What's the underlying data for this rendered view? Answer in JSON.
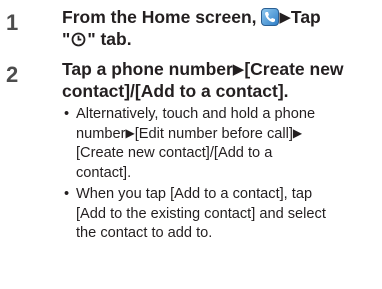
{
  "steps": [
    {
      "number": "1",
      "title_part1": "From the Home screen,",
      "title_part2": "Tap",
      "title_part3": "\"",
      "title_part4": "\" tab.",
      "app_icon": "phone-app-icon",
      "tab_icon": "clock-icon"
    },
    {
      "number": "2",
      "title_line1_a": "Tap a phone number",
      "title_line1_b": "[Create new",
      "title_line2": "contact]/[Add to a contact].",
      "bullets": [
        {
          "l1a": "Alternatively, touch and hold a phone",
          "l2a": "number",
          "l2b": "[Edit number before call]",
          "l3": "[Create new contact]/[Add to a",
          "l4": "contact]."
        },
        {
          "l1": "When you tap [Add to a contact], tap",
          "l2": "[Add to the existing contact] and select",
          "l3": "the contact to add to."
        }
      ]
    }
  ],
  "arrow_glyph": "▶",
  "bullet_glyph": "•"
}
